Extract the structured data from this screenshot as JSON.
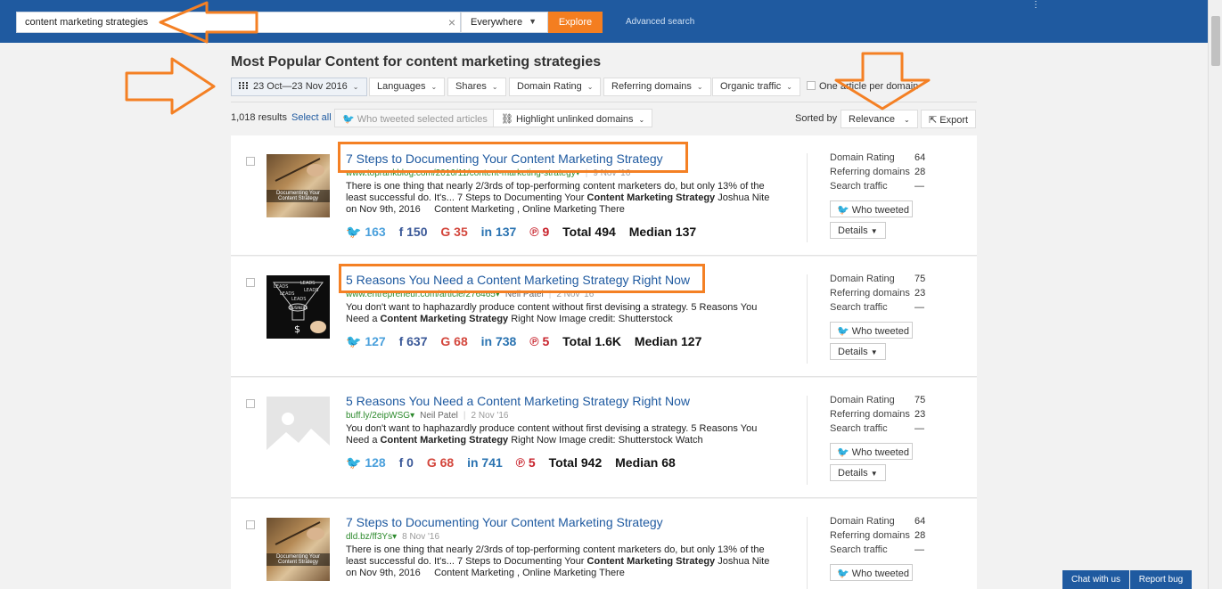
{
  "search": {
    "query": "content marketing strategies",
    "scope": "Everywhere",
    "explore_label": "Explore",
    "advanced_label": "Advanced search"
  },
  "page": {
    "title": "Most Popular Content for content marketing strategies"
  },
  "filters": {
    "date_range": "23 Oct—23 Nov 2016",
    "languages": "Languages",
    "shares": "Shares",
    "domain_rating": "Domain Rating",
    "referring_domains": "Referring domains",
    "organic_traffic": "Organic traffic",
    "one_article": "One article per domain"
  },
  "toolbar": {
    "results_count": "1,018 results",
    "select_all": "Select all",
    "who_tweeted_selected": "Who tweeted selected articles",
    "highlight_unlinked": "Highlight unlinked domains",
    "sorted_by": "Sorted by",
    "sort_value": "Relevance",
    "export": "Export"
  },
  "results": [
    {
      "title": "7 Steps to Documenting Your Content Marketing Strategy",
      "url": "www.toprankblog.com/2016/11/content-marketing-strategy",
      "author": "",
      "date": "9 Nov '16",
      "snippet_pre": "There is one thing that nearly 2/3rds of top-performing content marketers do, but only 13% of the least successful do. It's... 7 Steps to Documenting Your ",
      "snippet_bold": "Content Marketing Strategy",
      "snippet_post": " Joshua Nite on Nov 9th, 2016     Content Marketing , Online Marketing There",
      "twitter": "163",
      "facebook": "150",
      "google": "35",
      "linkedin": "137",
      "pinterest": "9",
      "total": "Total 494",
      "median": "Median 137",
      "domain_rating": "64",
      "referring_domains": "28",
      "search_traffic": "—",
      "thumb_text": "Documenting Your Content Strategy"
    },
    {
      "title": "5 Reasons You Need a Content Marketing Strategy Right Now",
      "url": "www.entrepreneur.com/article/276465",
      "author": "Neil Patel",
      "date": "2 Nov '16",
      "snippet_pre": "You don't want to haphazardly produce content without first devising a strategy. 5 Reasons You Need a ",
      "snippet_bold": "Content Marketing Strategy",
      "snippet_post": " Right Now Image credit: Shutterstock",
      "twitter": "127",
      "facebook": "637",
      "google": "68",
      "linkedin": "738",
      "pinterest": "5",
      "total": "Total 1.6K",
      "median": "Median 127",
      "domain_rating": "75",
      "referring_domains": "23",
      "search_traffic": "—",
      "thumb_labels": [
        "LEADS",
        "LEADS",
        "LEADS",
        "LEADS",
        "LEADS",
        "BUSINESS",
        "$"
      ]
    },
    {
      "title": "5 Reasons You Need a Content Marketing Strategy Right Now",
      "url": "buff.ly/2eipWSG",
      "author": "Neil Patel",
      "date": "2 Nov '16",
      "snippet_pre": "You don't want to haphazardly produce content without first devising a strategy. 5 Reasons You Need a ",
      "snippet_bold": "Content Marketing Strategy",
      "snippet_post": " Right Now Image credit: Shutterstock Watch",
      "twitter": "128",
      "facebook": "0",
      "google": "68",
      "linkedin": "741",
      "pinterest": "5",
      "total": "Total 942",
      "median": "Median 68",
      "domain_rating": "75",
      "referring_domains": "23",
      "search_traffic": "—"
    },
    {
      "title": "7 Steps to Documenting Your Content Marketing Strategy",
      "url": "dld.bz/ff3Ys",
      "author": "",
      "date": "8 Nov '16",
      "snippet_pre": "There is one thing that nearly 2/3rds of top-performing content marketers do, but only 13% of the least successful do. It's... 7 Steps to Documenting Your ",
      "snippet_bold": "Content Marketing Strategy",
      "snippet_post": " Joshua Nite on Nov 9th, 2016     Content Marketing , Online Marketing There",
      "domain_rating": "64",
      "referring_domains": "28",
      "search_traffic": "—",
      "thumb_text": "Documenting Your Content Strategy"
    }
  ],
  "labels": {
    "domain_rating": "Domain Rating",
    "referring_domains": "Referring domains",
    "search_traffic": "Search traffic",
    "who_tweeted": "Who tweeted",
    "details": "Details"
  },
  "footer": {
    "chat": "Chat with us",
    "report": "Report bug"
  },
  "colors": {
    "header": "#1f5aa0",
    "accent": "#f47e20",
    "annotation": "#f48024",
    "link": "#1f5aa0"
  }
}
